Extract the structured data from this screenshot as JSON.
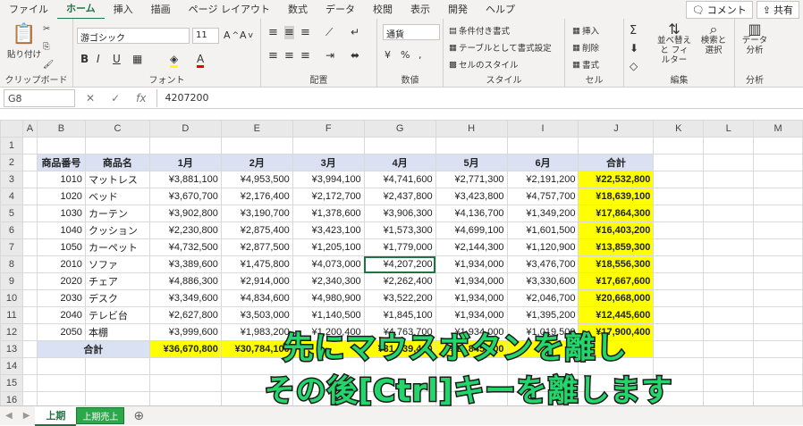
{
  "menu": {
    "tabs": [
      "ファイル",
      "ホーム",
      "挿入",
      "描画",
      "ページ レイアウト",
      "数式",
      "データ",
      "校閲",
      "表示",
      "開発",
      "ヘルプ"
    ],
    "comment_btn": "コメント",
    "share_btn": "共有"
  },
  "ribbon": {
    "clipboard": {
      "paste": "貼り付け",
      "label": "クリップボード"
    },
    "font": {
      "name": "游ゴシック",
      "size": "11",
      "label": "フォント"
    },
    "alignment": {
      "label": "配置"
    },
    "number": {
      "format": "通貨",
      "label": "数値"
    },
    "styles": {
      "cond": "条件付き書式",
      "table": "テーブルとして書式設定",
      "cell": "セルのスタイル",
      "label": "スタイル"
    },
    "cells": {
      "insert": "挿入",
      "delete": "削除",
      "format": "書式",
      "label": "セル"
    },
    "editing": {
      "sort": "並べ替えと フィルター",
      "find": "検索と 選択",
      "label": "編集"
    },
    "analysis": {
      "btn": "データ 分析",
      "label": "分析"
    }
  },
  "formula_bar": {
    "name_box": "G8",
    "value": "4207200"
  },
  "columns": [
    "A",
    "B",
    "C",
    "D",
    "E",
    "F",
    "G",
    "H",
    "I",
    "J",
    "K",
    "L",
    "M"
  ],
  "row_numbers": [
    "1",
    "2",
    "3",
    "4",
    "5",
    "6",
    "7",
    "8",
    "9",
    "10",
    "11",
    "12",
    "13",
    "14",
    "15",
    "16"
  ],
  "table": {
    "headers": [
      "商品番号",
      "商品名",
      "1月",
      "2月",
      "3月",
      "4月",
      "5月",
      "6月",
      "合計"
    ],
    "rows": [
      [
        "1010",
        "マットレス",
        "¥3,881,100",
        "¥4,953,500",
        "¥3,994,100",
        "¥4,741,600",
        "¥2,771,300",
        "¥2,191,200",
        "¥22,532,800"
      ],
      [
        "1020",
        "ベッド",
        "¥3,670,700",
        "¥2,176,400",
        "¥2,172,700",
        "¥2,437,800",
        "¥3,423,800",
        "¥4,757,700",
        "¥18,639,100"
      ],
      [
        "1030",
        "カーテン",
        "¥3,902,800",
        "¥3,190,700",
        "¥1,378,600",
        "¥3,906,300",
        "¥4,136,700",
        "¥1,349,200",
        "¥17,864,300"
      ],
      [
        "1040",
        "クッション",
        "¥2,230,800",
        "¥2,875,400",
        "¥3,423,100",
        "¥1,573,300",
        "¥4,699,100",
        "¥1,601,500",
        "¥16,403,200"
      ],
      [
        "1050",
        "カーペット",
        "¥4,732,500",
        "¥2,877,500",
        "¥1,205,100",
        "¥1,779,000",
        "¥2,144,300",
        "¥1,120,900",
        "¥13,859,300"
      ],
      [
        "2010",
        "ソファ",
        "¥3,389,600",
        "¥1,475,800",
        "¥4,073,000",
        "¥4,207,200",
        "¥1,934,000",
        "¥3,476,700",
        "¥18,556,300"
      ],
      [
        "2020",
        "チェア",
        "¥4,886,300",
        "¥2,914,000",
        "¥2,340,300",
        "¥2,262,400",
        "¥1,934,000",
        "¥3,330,600",
        "¥17,667,600"
      ],
      [
        "2030",
        "デスク",
        "¥3,349,600",
        "¥4,834,600",
        "¥4,980,900",
        "¥3,522,200",
        "¥1,934,000",
        "¥2,046,700",
        "¥20,668,000"
      ],
      [
        "2040",
        "テレビ台",
        "¥2,627,800",
        "¥3,503,000",
        "¥1,140,500",
        "¥1,845,100",
        "¥1,934,000",
        "¥1,395,200",
        "¥12,445,600"
      ],
      [
        "2050",
        "本棚",
        "¥3,999,600",
        "¥1,983,200",
        "¥1,200,400",
        "¥4,763,700",
        "¥1,934,000",
        "¥1,019,500",
        "¥17,900,400"
      ]
    ],
    "total_label": "合計",
    "totals": [
      "¥36,670,800",
      "¥30,784,100",
      "",
      "¥31,039,400",
      "¥11,845,000",
      "",
      ""
    ]
  },
  "sheet_tabs": {
    "active": "上期",
    "dragging": "上期売上"
  },
  "caption": {
    "line1": "先にマウスボタンを離し",
    "line2": "その後[Ctrl]キーを離します"
  }
}
